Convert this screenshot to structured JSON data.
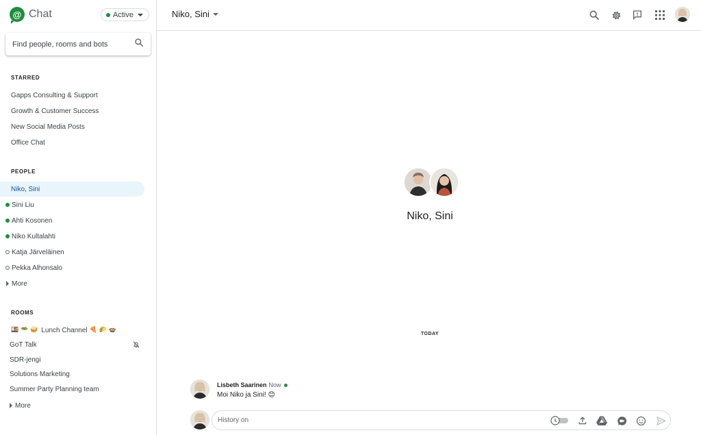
{
  "app": {
    "name": "Chat",
    "status": "Active",
    "brand_color": "#1e8e3e"
  },
  "search": {
    "placeholder": "Find people, rooms and bots"
  },
  "sidebar": {
    "starred_title": "STARRED",
    "starred": [
      {
        "label": "Gapps Consulting & Support"
      },
      {
        "label": "Growth & Customer Success"
      },
      {
        "label": "New Social Media Posts"
      },
      {
        "label": "Office Chat"
      }
    ],
    "people_title": "PEOPLE",
    "people": [
      {
        "label": "Niko, Sini",
        "selected": true,
        "presence": "none"
      },
      {
        "label": "Sini Liu",
        "presence": "online"
      },
      {
        "label": "Ahti Kosonen",
        "presence": "online"
      },
      {
        "label": "Niko Kultalahti",
        "presence": "online"
      },
      {
        "label": "Katja Järveläinen",
        "presence": "offline"
      },
      {
        "label": "Pekka Alhonsalo",
        "presence": "offline"
      }
    ],
    "people_more": "More",
    "rooms_title": "ROOMS",
    "rooms": [
      {
        "label": "Lunch Channel",
        "emoji_before": "🍱 🥗 🥪",
        "emoji_after": "🍕 🌮 🍲"
      },
      {
        "label": "GoT Talk",
        "muted": true
      },
      {
        "label": "SDR-jengi"
      },
      {
        "label": "Solutions Marketing"
      },
      {
        "label": "Summer Party Planning team"
      }
    ],
    "rooms_more": "More"
  },
  "header": {
    "title": "Niko, Sini",
    "icons": [
      "search-icon",
      "settings-icon",
      "feedback-icon",
      "apps-grid-icon",
      "account-avatar"
    ]
  },
  "conversation": {
    "name": "Niko, Sini",
    "day_divider": "TODAY",
    "messages": [
      {
        "sender": "Lisbeth Saarinen",
        "time": "Now",
        "text": "Moi Niko ja Sini! 😊"
      }
    ]
  },
  "compose": {
    "placeholder": "History on",
    "icons": [
      "history-toggle",
      "upload-icon",
      "drive-icon",
      "meet-icon",
      "emoji-icon",
      "send-icon"
    ]
  }
}
